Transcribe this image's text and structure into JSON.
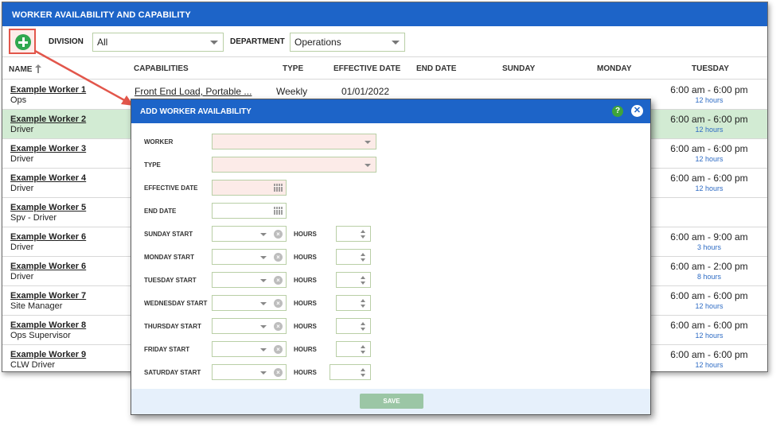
{
  "window": {
    "title": "WORKER AVAILABILITY AND CAPABILITY"
  },
  "filters": {
    "division_label": "DIVISION",
    "division_value": "All",
    "department_label": "DEPARTMENT",
    "department_value": "Operations"
  },
  "columns": {
    "name": "NAME",
    "capabilities": "CAPABILITIES",
    "type": "TYPE",
    "effective_date": "EFFECTIVE DATE",
    "end_date": "END DATE",
    "sunday": "SUNDAY",
    "monday": "MONDAY",
    "tuesday": "TUESDAY"
  },
  "rows": [
    {
      "name": "Example Worker 1",
      "role": "Ops",
      "capabilities": "Front End Load, Portable ...",
      "type": "Weekly",
      "effective": "01/01/2022",
      "tuesday": "6:00 am - 6:00 pm",
      "tuesday_hours": "12 hours"
    },
    {
      "name": "Example Worker 2",
      "role": "Driver",
      "capabilities": "",
      "type": "",
      "effective": "",
      "tuesday": "6:00 am - 6:00 pm",
      "tuesday_hours": "12 hours"
    },
    {
      "name": "Example Worker 3",
      "role": "Driver",
      "capabilities": "",
      "type": "",
      "effective": "",
      "tuesday": "6:00 am - 6:00 pm",
      "tuesday_hours": "12 hours"
    },
    {
      "name": "Example Worker 4",
      "role": "Driver",
      "capabilities": "",
      "type": "",
      "effective": "",
      "tuesday": "6:00 am - 6:00 pm",
      "tuesday_hours": "12 hours"
    },
    {
      "name": "Example Worker 5",
      "role": "Spv - Driver",
      "capabilities": "",
      "type": "",
      "effective": "",
      "tuesday": "",
      "tuesday_hours": ""
    },
    {
      "name": "Example Worker 6",
      "role": "Driver",
      "capabilities": "",
      "type": "",
      "effective": "",
      "tuesday": "6:00 am - 9:00 am",
      "tuesday_hours": "3 hours"
    },
    {
      "name": "Example Worker 6",
      "role": "Driver",
      "capabilities": "",
      "type": "",
      "effective": "",
      "tuesday": "6:00 am - 2:00 pm",
      "tuesday_hours": "8 hours"
    },
    {
      "name": "Example Worker 7",
      "role": "Site Manager",
      "capabilities": "",
      "type": "",
      "effective": "",
      "tuesday": "6:00 am - 6:00 pm",
      "tuesday_hours": "12 hours"
    },
    {
      "name": "Example Worker 8",
      "role": "Ops Supervisor",
      "capabilities": "",
      "type": "",
      "effective": "",
      "tuesday": "6:00 am - 6:00 pm",
      "tuesday_hours": "12 hours"
    },
    {
      "name": "Example Worker 9",
      "role": "CLW Driver",
      "capabilities": "",
      "type": "",
      "effective": "",
      "tuesday": "6:00 am - 6:00 pm",
      "tuesday_hours": "12 hours"
    }
  ],
  "modal": {
    "title": "ADD WORKER AVAILABILITY",
    "help_glyph": "?",
    "close_glyph": "✕",
    "worker_label": "WORKER",
    "type_label": "TYPE",
    "effective_date_label": "EFFECTIVE DATE",
    "end_date_label": "END DATE",
    "hours_label": "HOURS",
    "days": [
      {
        "label": "SUNDAY START"
      },
      {
        "label": "MONDAY START"
      },
      {
        "label": "TUESDAY START"
      },
      {
        "label": "WEDNESDAY START"
      },
      {
        "label": "THURSDAY START"
      },
      {
        "label": "FRIDAY START"
      },
      {
        "label": "SATURDAY START"
      }
    ],
    "save_label": "SAVE"
  },
  "colors": {
    "header_blue": "#1d64c8",
    "selected_row": "#d2ebd3",
    "highlight_red": "#e2564b",
    "add_green": "#2fa84f",
    "hours_blue": "#2d6bc4"
  }
}
